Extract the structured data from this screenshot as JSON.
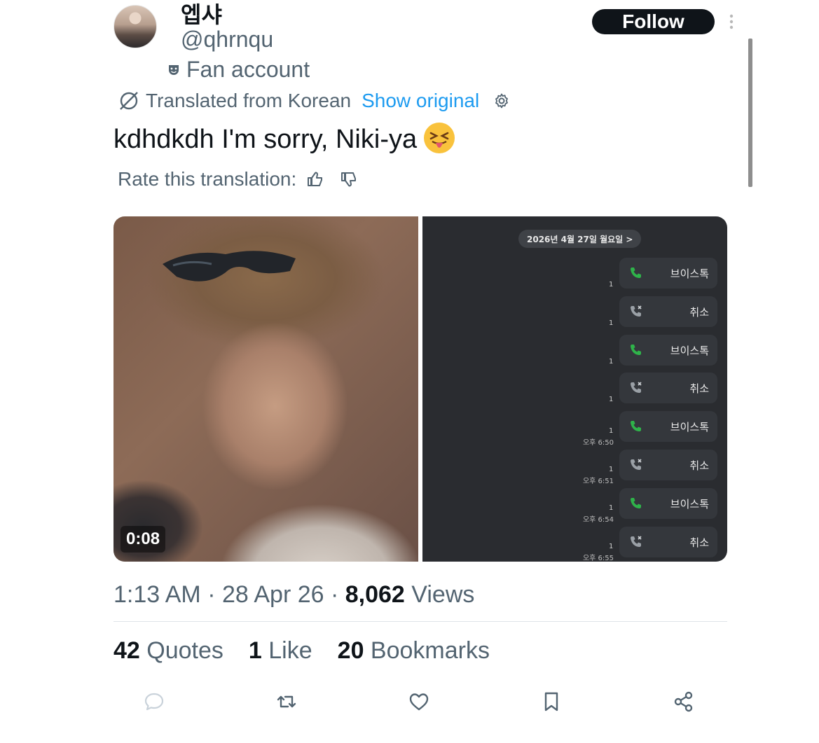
{
  "author": {
    "display_name": "엡샤",
    "handle": "@qhrnqu",
    "badge_label": "Fan account"
  },
  "header": {
    "follow_label": "Follow"
  },
  "translation": {
    "translated_from": "Translated from Korean",
    "show_original": "Show original",
    "rate_label": "Rate this translation:"
  },
  "tweet": {
    "text": "kdhdkdh I'm sorry, Niki-ya",
    "emoji": "squinting-face-with-tongue"
  },
  "media": {
    "video_duration": "0:08",
    "chat_date": "2026년 4월 27일 월요일 >",
    "calls": [
      {
        "label": "브이스톡",
        "type": "voice",
        "count": "1",
        "time": ""
      },
      {
        "label": "취소",
        "type": "cancel",
        "count": "1",
        "time": ""
      },
      {
        "label": "브이스톡",
        "type": "voice",
        "count": "1",
        "time": ""
      },
      {
        "label": "취소",
        "type": "cancel",
        "count": "1",
        "time": ""
      },
      {
        "label": "브이스톡",
        "type": "voice",
        "count": "1",
        "time": "오후 6:50"
      },
      {
        "label": "취소",
        "type": "cancel",
        "count": "1",
        "time": "오후 6:51"
      },
      {
        "label": "브이스톡",
        "type": "voice",
        "count": "1",
        "time": "오후 6:54"
      },
      {
        "label": "취소",
        "type": "cancel",
        "count": "1",
        "time": "오후 6:55"
      }
    ]
  },
  "meta": {
    "time": "1:13 AM",
    "sep1": " · ",
    "date": "28 Apr 26",
    "sep2": " · ",
    "views_count": "8,062",
    "views_label": " Views"
  },
  "stats": {
    "quotes_count": "42",
    "quotes_label": " Quotes",
    "likes_count": "1",
    "likes_label": " Like",
    "bookmarks_count": "20",
    "bookmarks_label": " Bookmarks"
  },
  "colors": {
    "accent": "#1d9bf0",
    "text_primary": "#0f1419",
    "text_secondary": "#536471",
    "call_green": "#2fb34a"
  }
}
